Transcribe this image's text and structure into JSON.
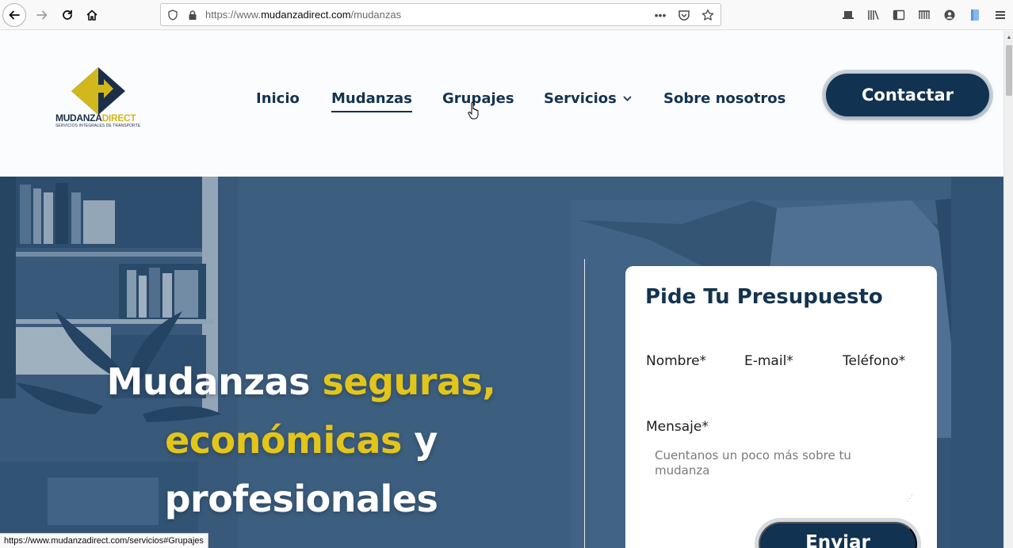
{
  "browser": {
    "url_prefix": "https://www.",
    "url_host": "mudanzadirect.com",
    "url_path": "/mudanzas",
    "status_url": "https://www.mudanzadirect.com/servicios#Grupajes",
    "icons": [
      "back-arrow-icon",
      "forward-arrow-icon",
      "reload-icon",
      "home-icon",
      "shield-icon",
      "lock-icon",
      "more-dots-icon",
      "pocket-icon",
      "star-icon",
      "library-icon",
      "sidebar-icon",
      "reader-icon",
      "account-icon",
      "extension-icon",
      "hamburger-menu-icon"
    ]
  },
  "logo": {
    "name_part1": "MUDANZA",
    "name_part2": "DIRECT",
    "tagline": "SERVICIOS INTEGRALES DE TRANSPORTE",
    "colors": {
      "navy": "#1b2f4a",
      "gold": "#d1b81c"
    }
  },
  "nav": {
    "items": [
      {
        "label": "Inicio"
      },
      {
        "label": "Mudanzas"
      },
      {
        "label": "Grupajes"
      },
      {
        "label": "Servicios"
      },
      {
        "label": "Sobre nosotros"
      }
    ],
    "active": "Mudanzas",
    "cta_label": "Contactar"
  },
  "hero": {
    "headline_w1": "Mudanzas ",
    "headline_w2": "seguras,",
    "headline_w3": "económicas",
    "headline_w4": " y",
    "headline_w5": "profesionales",
    "highlight_color": "#e3c51a"
  },
  "form": {
    "title": "Pide Tu Presupuesto",
    "name_label": "Nombre*",
    "email_label": "E-mail*",
    "phone_label": "Teléfono*",
    "message_label": "Mensaje*",
    "message_placeholder": "Cuentanos un poco más sobre tu mudanza",
    "submit_label": "Enviar"
  },
  "colors": {
    "brand_navy": "#113250",
    "accent_yellow": "#e3c51a"
  }
}
